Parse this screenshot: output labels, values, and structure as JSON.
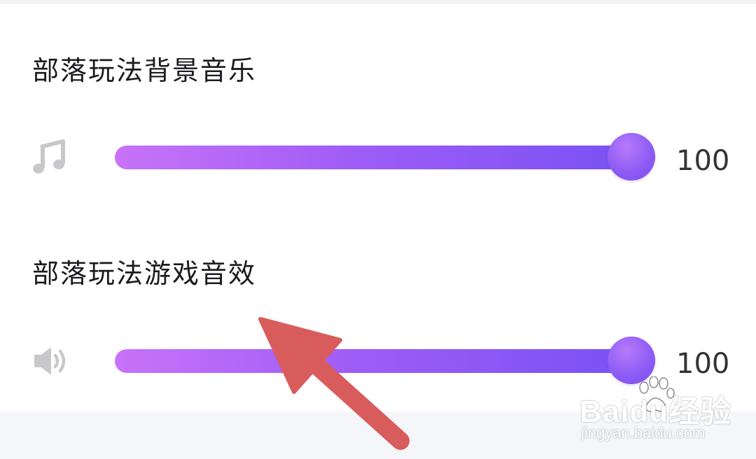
{
  "settings": {
    "background_music": {
      "title": "部落玩法背景音乐",
      "icon": "music-note-icon",
      "value": "100",
      "level_percent": 100
    },
    "sound_effects": {
      "title": "部落玩法游戏音效",
      "icon": "speaker-icon",
      "value": "100",
      "level_percent": 100
    }
  },
  "watermark": {
    "logo_text": "Baidu经验",
    "url": "jingyan.baidu.com"
  },
  "colors": {
    "slider_start": "#c873f8",
    "slider_end": "#7651f4",
    "arrow": "#d95c5c",
    "icon": "#c8c8cc"
  }
}
